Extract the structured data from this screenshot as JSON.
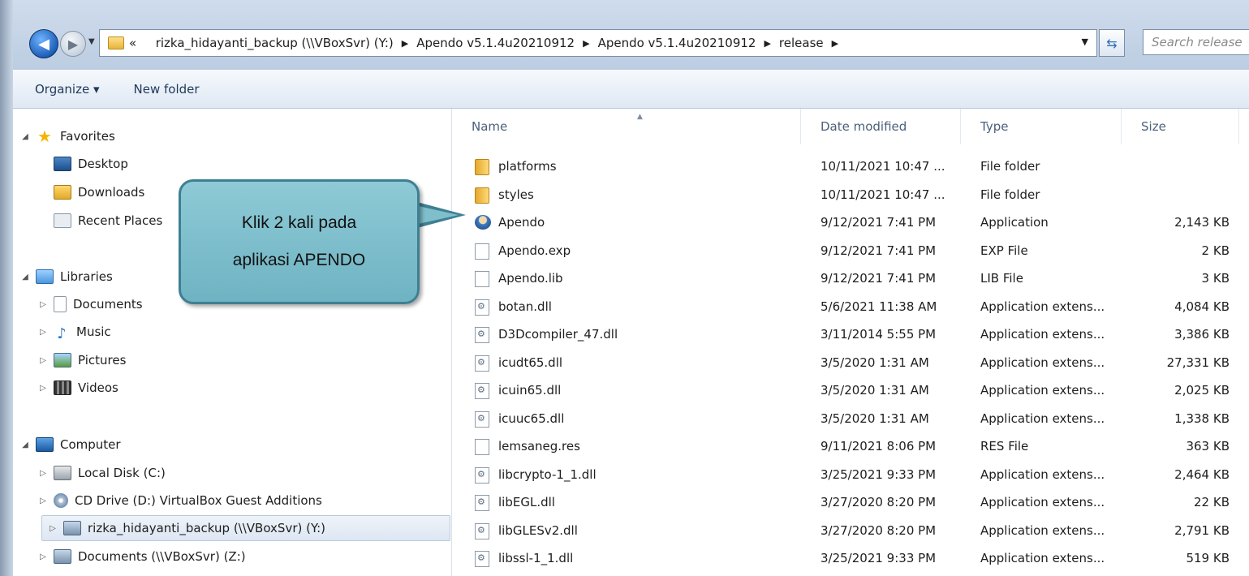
{
  "address": {
    "prefix": "«",
    "crumbs": [
      "rizka_hidayanti_backup (\\\\VBoxSvr) (Y:)",
      "Apendo v5.1.4u20210912",
      "Apendo v5.1.4u20210912",
      "release"
    ],
    "search_placeholder": "Search release"
  },
  "toolbar": {
    "organize": "Organize ▾",
    "new_folder": "New folder"
  },
  "nav": {
    "favorites": "Favorites",
    "desktop": "Desktop",
    "downloads": "Downloads",
    "recent": "Recent Places",
    "libraries": "Libraries",
    "documents": "Documents",
    "music": "Music",
    "pictures": "Pictures",
    "videos": "Videos",
    "computer": "Computer",
    "local_disk": "Local Disk (C:)",
    "cd_drive": "CD Drive (D:) VirtualBox Guest Additions",
    "rizka": "rizka_hidayanti_backup (\\\\VBoxSvr) (Y:)",
    "docs_net": "Documents (\\\\VBoxSvr) (Z:)"
  },
  "callout": {
    "line1": "Klik 2 kali pada",
    "line2": "aplikasi APENDO"
  },
  "columns": {
    "name": "Name",
    "date": "Date modified",
    "type": "Type",
    "size": "Size"
  },
  "files": [
    {
      "name": "platforms",
      "date": "10/11/2021 10:47 ...",
      "type": "File folder",
      "size": "",
      "icon": "folder"
    },
    {
      "name": "styles",
      "date": "10/11/2021 10:47 ...",
      "type": "File folder",
      "size": "",
      "icon": "folder"
    },
    {
      "name": "Apendo",
      "date": "9/12/2021 7:41 PM",
      "type": "Application",
      "size": "2,143 KB",
      "icon": "app"
    },
    {
      "name": "Apendo.exp",
      "date": "9/12/2021 7:41 PM",
      "type": "EXP File",
      "size": "2 KB",
      "icon": "blank"
    },
    {
      "name": "Apendo.lib",
      "date": "9/12/2021 7:41 PM",
      "type": "LIB File",
      "size": "3 KB",
      "icon": "blank"
    },
    {
      "name": "botan.dll",
      "date": "5/6/2021 11:38 AM",
      "type": "Application extens...",
      "size": "4,084 KB",
      "icon": "dll"
    },
    {
      "name": "D3Dcompiler_47.dll",
      "date": "3/11/2014 5:55 PM",
      "type": "Application extens...",
      "size": "3,386 KB",
      "icon": "dll"
    },
    {
      "name": "icudt65.dll",
      "date": "3/5/2020 1:31 AM",
      "type": "Application extens...",
      "size": "27,331 KB",
      "icon": "dll"
    },
    {
      "name": "icuin65.dll",
      "date": "3/5/2020 1:31 AM",
      "type": "Application extens...",
      "size": "2,025 KB",
      "icon": "dll"
    },
    {
      "name": "icuuc65.dll",
      "date": "3/5/2020 1:31 AM",
      "type": "Application extens...",
      "size": "1,338 KB",
      "icon": "dll"
    },
    {
      "name": "lemsaneg.res",
      "date": "9/11/2021 8:06 PM",
      "type": "RES File",
      "size": "363 KB",
      "icon": "blank"
    },
    {
      "name": "libcrypto-1_1.dll",
      "date": "3/25/2021 9:33 PM",
      "type": "Application extens...",
      "size": "2,464 KB",
      "icon": "dll"
    },
    {
      "name": "libEGL.dll",
      "date": "3/27/2020 8:20 PM",
      "type": "Application extens...",
      "size": "22 KB",
      "icon": "dll"
    },
    {
      "name": "libGLESv2.dll",
      "date": "3/27/2020 8:20 PM",
      "type": "Application extens...",
      "size": "2,791 KB",
      "icon": "dll"
    },
    {
      "name": "libssl-1_1.dll",
      "date": "3/25/2021 9:33 PM",
      "type": "Application extens...",
      "size": "519 KB",
      "icon": "dll"
    }
  ]
}
